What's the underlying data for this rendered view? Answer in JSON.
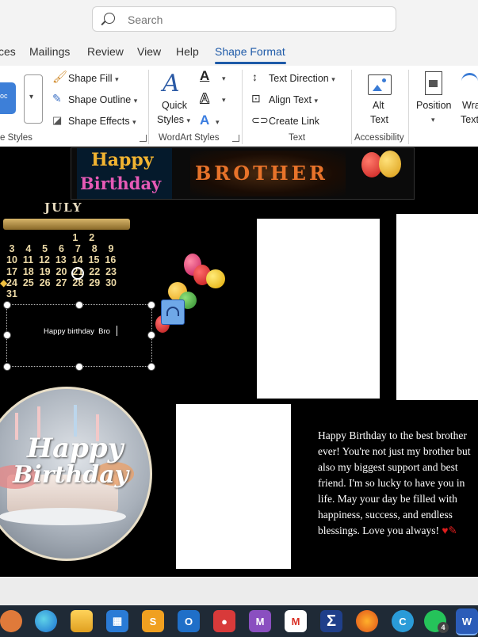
{
  "search": {
    "placeholder": "Search"
  },
  "tabs": [
    {
      "label": "ces"
    },
    {
      "label": "Mailings"
    },
    {
      "label": "Review"
    },
    {
      "label": "View"
    },
    {
      "label": "Help"
    },
    {
      "label": "Shape Format",
      "active": true
    }
  ],
  "ribbon": {
    "shape_styles": {
      "group_label": "e Styles",
      "fill": "Shape Fill",
      "outline": "Shape Outline",
      "effects": "Shape Effects"
    },
    "wordart_styles": {
      "group_label": "WordArt Styles",
      "quick_styles_line1": "Quick",
      "quick_styles_line2": "Styles"
    },
    "text": {
      "group_label": "Text",
      "direction": "Text Direction",
      "align": "Align Text",
      "link": "Create Link"
    },
    "accessibility": {
      "group_label": "Accessibility",
      "alt_line1": "Alt",
      "alt_line2": "Text"
    },
    "arrange": {
      "position": "Position",
      "wrap_line1": "Wra",
      "wrap_line2": "Text"
    }
  },
  "document": {
    "banner": {
      "happy": "Happy",
      "birthday": "Birthday",
      "brother": "BROTHER"
    },
    "calendar": {
      "month": "JULY",
      "rows": [
        "                        1    2",
        " 3    4    5    6    7    8    9",
        "10  11  12  13  14  15  16",
        "17  18  19  20  21  22  23",
        "24  25  26  27  28  29  30",
        "31"
      ]
    },
    "textbox_text": "Happy birthday  Bro",
    "cake": {
      "line1": "Happy",
      "line2": "Birthday"
    },
    "greeting": "Happy Birthday to the best brother ever! You're not just my brother but also my biggest support and best friend. I'm so lucky to have you in life. May your day be filled with happiness, success, and endless blessings. Love you always!",
    "greeting_emoji": "♥✎"
  },
  "taskbar": {
    "icons": [
      "start-icon",
      "edge-icon",
      "file-explorer-icon",
      "store-icon",
      "app-s-icon",
      "outlook-icon",
      "recorder-icon",
      "ms-app-icon",
      "gmail-icon",
      "sigma-app-icon",
      "firefox-icon",
      "c-app-icon",
      "whatsapp-icon",
      "word-icon"
    ],
    "whatsapp_badge": "4",
    "word_label": "W"
  },
  "colors": {
    "accent": "#1e5aa8",
    "doc_bg": "#000000",
    "taskbar": "#1f2a36"
  }
}
